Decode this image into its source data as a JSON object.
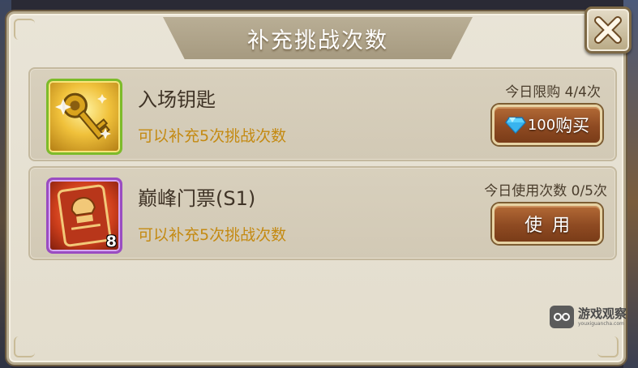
{
  "dialog": {
    "title": "补充挑战次数",
    "close_icon": "close-x-icon"
  },
  "items": [
    {
      "name": "入场钥匙",
      "icon": "golden-key-icon",
      "description": "可以补充5次挑战次数",
      "limit_text": "今日限购 4/4次",
      "button": {
        "icon": "diamond-gem-icon",
        "price": "100",
        "label": "购买"
      },
      "frame_color": "#7dbb2a"
    },
    {
      "name": "巅峰门票(S1)",
      "icon": "ticket-card-icon",
      "count": "8",
      "description": "可以补充5次挑战次数",
      "limit_text": "今日使用次数 0/5次",
      "button": {
        "label": "使用"
      },
      "frame_color": "#9a4cc2"
    }
  ],
  "watermark": {
    "main": "游戏观察",
    "sub": "youxiguancha.com"
  },
  "colors": {
    "description_text": "#c48a12",
    "button_brown": "#8e4a22",
    "panel_bg": "#e9e4d7"
  }
}
